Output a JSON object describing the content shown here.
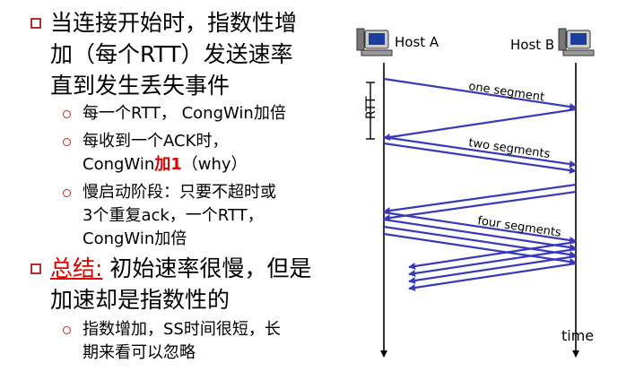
{
  "bullets": {
    "b1_line1": "当连接开始时，指数性增",
    "b1_line2": "加（每个RTT）发送速率",
    "b1_line3": "直到发生丢失事件",
    "s1": "每一个RTT， CongWin加倍",
    "s2_line1": "每收到一个ACK时，",
    "s2_line2_a": "CongWin",
    "s2_line2_red": "加1",
    "s2_line2_b": "（why）",
    "s3_line1": "慢启动阶段：只要不超时或",
    "s3_line2": "3个重复ack，一个RTT，",
    "s3_line3": "CongWin加倍",
    "b2_label": "总结:",
    "b2_line1_rest": " 初始速率很慢，但是",
    "b2_line2": "加速却是指数性的",
    "s4_line1": "指数增加，SS时间很短，长",
    "s4_line2": "期来看可以忽略"
  },
  "diagram": {
    "host_a": "Host A",
    "host_b": "Host B",
    "rtt": "RTT",
    "one_segment": "one segment",
    "two_segments": "two segments",
    "four_segments": "four segments",
    "time": "time"
  },
  "colors": {
    "arrow": "#3a3ab8",
    "bullet": "#b03030",
    "highlight": "#e00000"
  }
}
